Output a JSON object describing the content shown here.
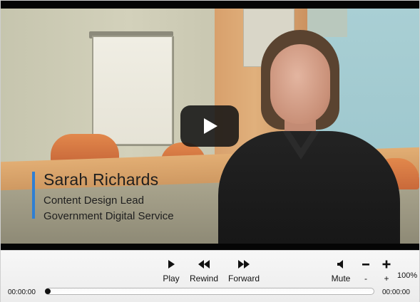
{
  "video": {
    "lower_third": {
      "name": "Sarah Richards",
      "role": "Content Design Lead",
      "organisation": "Government Digital Service"
    },
    "accent_color": "#2f7fd3",
    "play_overlay_icon": "play-icon"
  },
  "controls": {
    "play": {
      "label": "Play",
      "icon": "play-icon"
    },
    "rewind": {
      "label": "Rewind",
      "icon": "rewind-icon"
    },
    "forward": {
      "label": "Forward",
      "icon": "forward-icon"
    },
    "mute": {
      "label": "Mute",
      "icon": "speaker-icon"
    },
    "volume_down": {
      "label": "-",
      "icon": "minus-icon"
    },
    "volume_up": {
      "label": "+",
      "icon": "plus-icon"
    },
    "volume_level": "100%"
  },
  "progress": {
    "elapsed": "00:00:00",
    "total": "00:00:00",
    "fraction": 0.0
  }
}
